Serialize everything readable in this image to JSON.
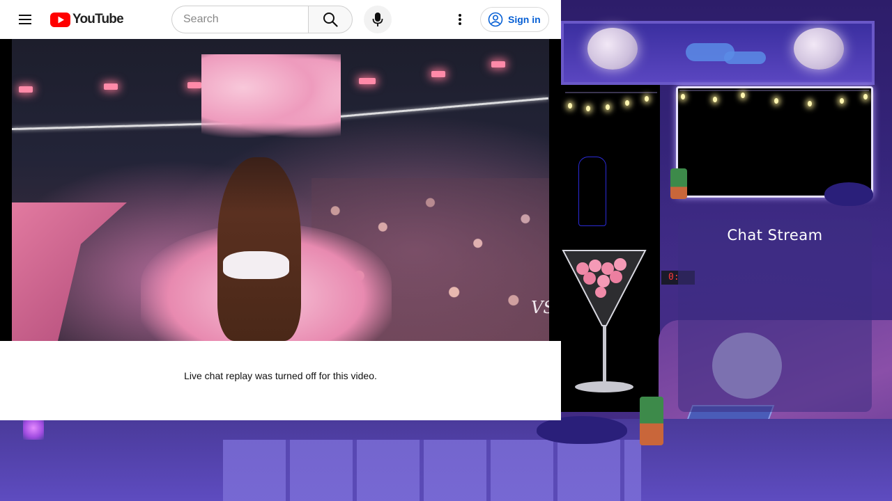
{
  "youtube": {
    "logo_text": "YouTube",
    "search": {
      "placeholder": "Search",
      "value": ""
    },
    "signin_label": "Sign in",
    "video_watermark": "VS",
    "chat_replay_message": "Live chat replay was turned off for this video."
  },
  "overlay": {
    "chat_title": "Chat Stream",
    "clock_text": "0:"
  },
  "icons": {
    "menu": "hamburger-icon",
    "logo": "youtube-play-icon",
    "search": "search-icon",
    "mic": "microphone-icon",
    "more": "more-vert-icon",
    "account": "account-circle-icon"
  },
  "colors": {
    "youtube_red": "#ff0000",
    "signin_blue": "#065fd4",
    "overlay_purple": "#3b2a86"
  }
}
